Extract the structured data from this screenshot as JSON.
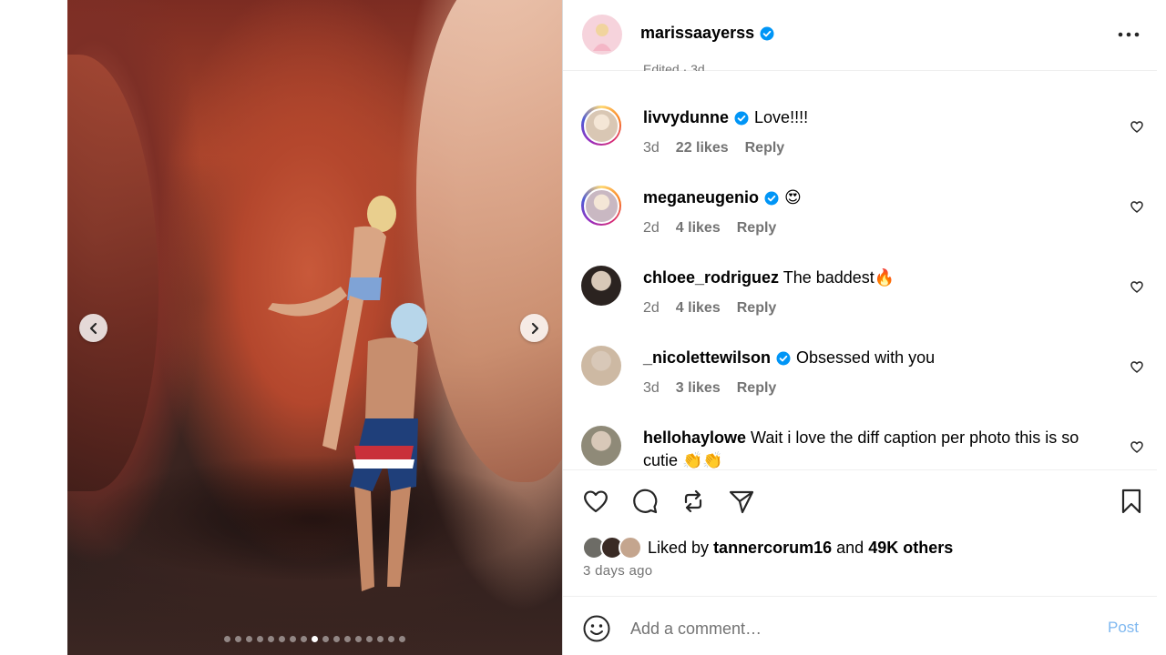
{
  "post": {
    "username": "marissaayerss",
    "verified": true,
    "faded_line": "Edited · 3d",
    "carousel": {
      "total": 17,
      "active_index": 8
    }
  },
  "comments": [
    {
      "username": "livvydunne",
      "verified": true,
      "text": "Love!!!!",
      "time": "3d",
      "likes": "22 likes",
      "reply": "Reply",
      "story_ring": true,
      "avatar_color": "#d9c7b4"
    },
    {
      "username": "meganeugenio",
      "verified": true,
      "text": "😍",
      "time": "2d",
      "likes": "4 likes",
      "reply": "Reply",
      "story_ring": true,
      "avatar_color": "#c9b8c2"
    },
    {
      "username": "chloee_rodriguez",
      "verified": false,
      "text": "The baddest🔥",
      "time": "2d",
      "likes": "4 likes",
      "reply": "Reply",
      "story_ring": false,
      "avatar_color": "#2b2320"
    },
    {
      "username": "_nicolettewilson",
      "verified": true,
      "text": "Obsessed with you",
      "time": "3d",
      "likes": "3 likes",
      "reply": "Reply",
      "story_ring": false,
      "avatar_color": "#cdb9a3"
    },
    {
      "username": "hellohaylowe",
      "verified": false,
      "text": "Wait i love the diff caption per photo this is so cutie 👏👏",
      "time": "",
      "likes": "",
      "reply": "",
      "story_ring": false,
      "avatar_color": "#8f8a78"
    }
  ],
  "liked": {
    "prefix": "Liked by",
    "user": "tannercorum16",
    "and": "and",
    "others": "49K others"
  },
  "timestamp": "3 days ago",
  "add_comment": {
    "placeholder": "Add a comment…",
    "post_label": "Post"
  },
  "colors": {
    "verified": "#0095f6",
    "post_button": "#7fb8f0",
    "muted": "#737373"
  }
}
